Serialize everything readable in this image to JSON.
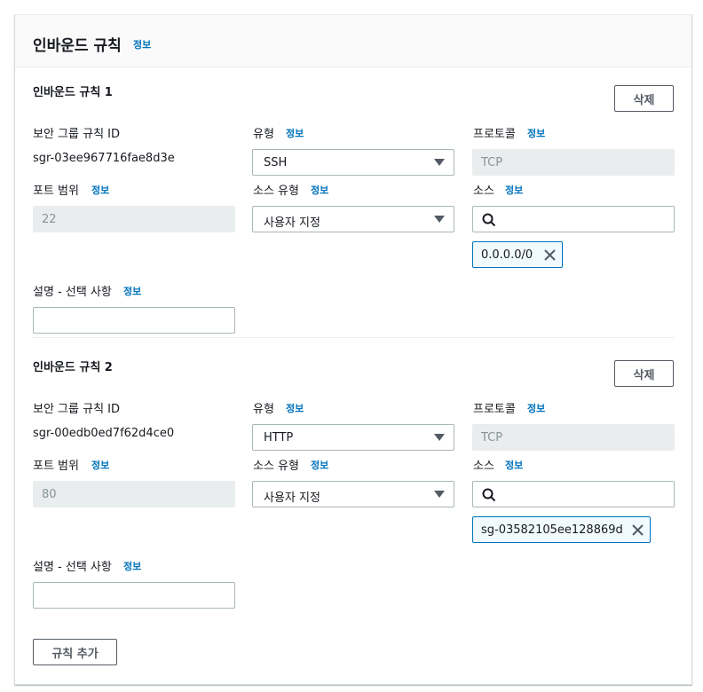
{
  "header": {
    "title": "인바운드 규칙",
    "info": "정보"
  },
  "labels": {
    "rule_id": "보안 그룹 규칙 ID",
    "type": "유형",
    "protocol": "프로토콜",
    "port_range": "포트 범위",
    "source_type": "소스 유형",
    "source": "소스",
    "description": "설명 - 선택 사항",
    "info": "정보",
    "delete": "삭제"
  },
  "rules": [
    {
      "title": "인바운드 규칙 1",
      "rule_id": "sgr-03ee967716fae8d3e",
      "type": "SSH",
      "protocol": "TCP",
      "port_range": "22",
      "source_type": "사용자 지정",
      "source_token": "0.0.0.0/0",
      "description": ""
    },
    {
      "title": "인바운드 규칙 2",
      "rule_id": "sgr-00edb0ed7f62d4ce0",
      "type": "HTTP",
      "protocol": "TCP",
      "port_range": "80",
      "source_type": "사용자 지정",
      "source_token": "sg-03582105ee128869d",
      "description": ""
    }
  ],
  "footer": {
    "add_rule": "규칙 추가"
  }
}
